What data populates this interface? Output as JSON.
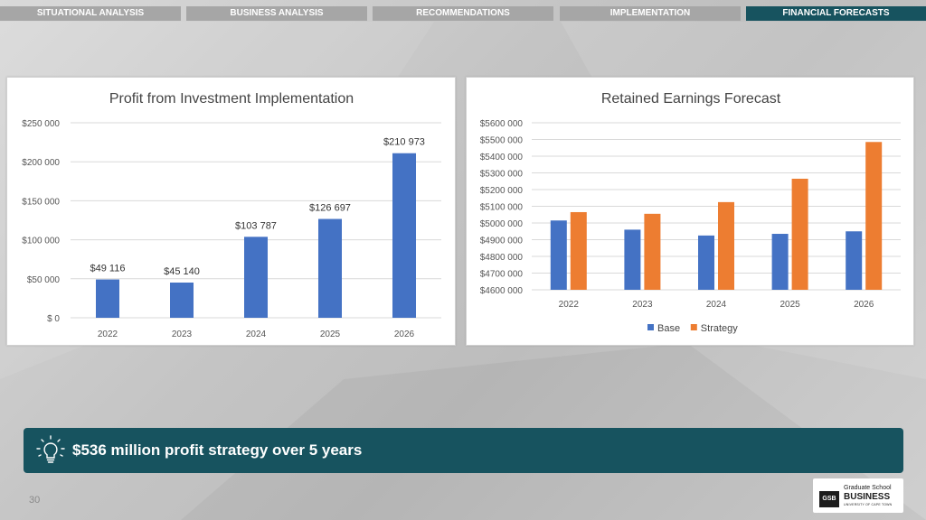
{
  "nav": {
    "tabs": [
      {
        "label": "SITUATIONAL ANALYSIS",
        "active": false
      },
      {
        "label": "BUSINESS ANALYSIS",
        "active": false
      },
      {
        "label": "RECOMMENDATIONS",
        "active": false
      },
      {
        "label": "IMPLEMENTATION",
        "active": false
      },
      {
        "label": "FINANCIAL FORECASTS",
        "active": true
      }
    ],
    "active_color": "#17535f",
    "inactive_color": "#a6a6a6"
  },
  "chart_data": [
    {
      "type": "bar",
      "title": "Profit from Investment Implementation",
      "categories": [
        "2022",
        "2023",
        "2024",
        "2025",
        "2026"
      ],
      "values": [
        49116,
        45140,
        103787,
        126697,
        210973
      ],
      "data_labels": [
        "$49 116",
        "$45 140",
        "$103 787",
        "$126 697",
        "$210 973"
      ],
      "yticks": [
        0,
        50000,
        100000,
        150000,
        200000,
        250000
      ],
      "ytick_labels": [
        "$ 0",
        "$50 000",
        "$100 000",
        "$150 000",
        "$200 000",
        "$250 000"
      ],
      "ylim": [
        0,
        250000
      ],
      "grid": true,
      "color": "#4472c4"
    },
    {
      "type": "bar",
      "title": "Retained Earnings Forecast",
      "categories": [
        "2022",
        "2023",
        "2024",
        "2025",
        "2026"
      ],
      "series": [
        {
          "name": "Base",
          "values": [
            5015,
            4960,
            4925,
            4935,
            4950
          ],
          "color": "#4472c4"
        },
        {
          "name": "Strategy",
          "values": [
            5065,
            5055,
            5125,
            5265,
            5485
          ],
          "color": "#ed7d31"
        }
      ],
      "yticks": [
        4600,
        4700,
        4800,
        4900,
        5000,
        5100,
        5200,
        5300,
        5400,
        5500,
        5600
      ],
      "ytick_labels": [
        "$4600 000",
        "$4700 000",
        "$4800 000",
        "$4900 000",
        "$5000 000",
        "$5100 000",
        "$5200 000",
        "$5300 000",
        "$5400 000",
        "$5500 000",
        "$5600 000"
      ],
      "ylim": [
        4600,
        5600
      ],
      "grid": true,
      "legend": "bottom"
    }
  ],
  "banner": {
    "icon": "lightbulb-icon",
    "text": "$536 million profit strategy over 5 years",
    "color": "#17535f"
  },
  "page_number": "30",
  "logo": {
    "mark": "GSB",
    "line1": "Graduate School",
    "line2": "BUSINESS",
    "line3": "UNIVERSITY OF CAPE TOWN"
  }
}
